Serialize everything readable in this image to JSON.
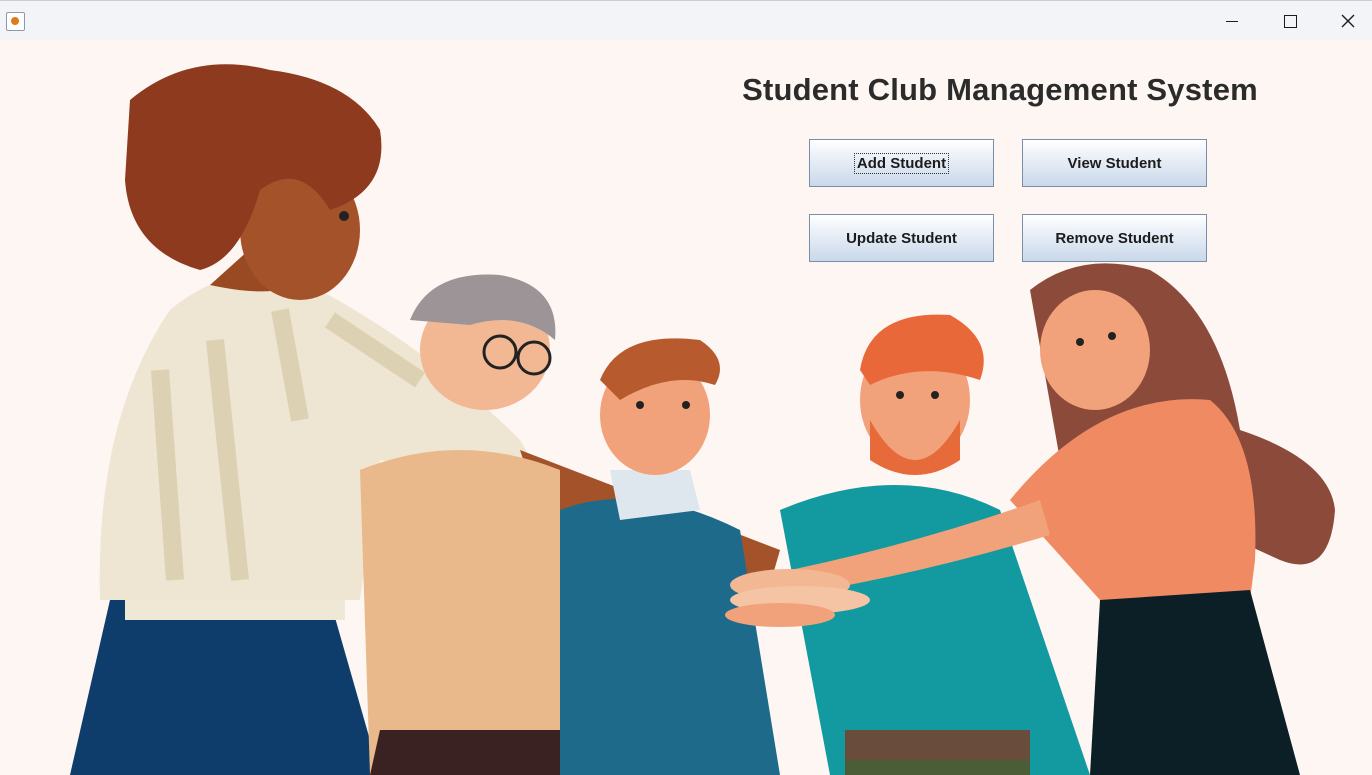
{
  "window": {
    "icon": "java-app-icon",
    "controls": [
      "minimize-icon",
      "maximize-icon",
      "close-icon"
    ]
  },
  "main": {
    "title": "Student Club Management System",
    "buttons": {
      "add": "Add Student",
      "view": "View Student",
      "update": "Update Student",
      "remove": "Remove Student"
    }
  },
  "colors": {
    "background": "#fdf6f2",
    "button_gradient_top": "#ffffff",
    "button_gradient_bottom": "#c9d8ea",
    "button_border": "#7a8ea8",
    "title_text": "#2b2b2b"
  }
}
